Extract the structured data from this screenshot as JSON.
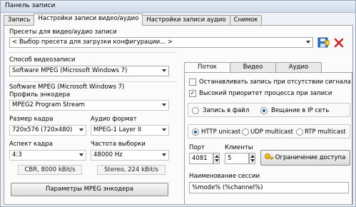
{
  "window": {
    "title": "Панель записи"
  },
  "tabs": [
    "Запись",
    "Настройки записи видео/аудио",
    "Настройки записи аудио",
    "Снимок"
  ],
  "presets": {
    "label": "Пресеты для видео/аудио записи",
    "value": "< Выбор пресета для загрузки конфигурации... >"
  },
  "capture": {
    "label": "Способ видеозаписи",
    "value": "Software MPEG (Microsoft Windows 7)"
  },
  "software": {
    "label": "Software MPEG (Microsoft Windows 7)",
    "encoder_profile_label": "Профиль энкодера",
    "encoder_profile_value": "MPEG2 Program Stream",
    "frame_size_label": "Размер кадра",
    "frame_size_value": "720x576 (720x480)",
    "audio_format_label": "Аудио формат",
    "audio_format_value": "MPEG-1 Layer II",
    "aspect_label": "Аспект кадра",
    "aspect_value": "4:3",
    "sample_rate_label": "Частота выборки",
    "sample_rate_value": "48000 Hz",
    "video_info": "CBR, 8000 kBit/s",
    "audio_info": "Stereo, 224 kBit/s",
    "mpeg_params_button": "Параметры MPEG энкодера"
  },
  "subtabs": [
    "Поток",
    "Видео",
    "Аудио"
  ],
  "stream": {
    "stop_on_no_signal": "Останавливать запись при отсутствии сигнала",
    "high_priority": "Высокий приоритет процесса при записи",
    "record_to_file": "Запись в файл",
    "broadcast_ip": "Вещание в IP сеть",
    "http_unicast": "HTTP unicast",
    "udp_multicast": "UDP multicast",
    "rtp_multicast": "RTP multicast",
    "port_label": "Порт",
    "port_value": "4081",
    "clients_label": "Клиенты",
    "clients_value": "5",
    "access_limit_button": "Ограничение доступа",
    "session_name_label": "Наименование сессии",
    "session_name_value": "%mode% (%channel%)"
  }
}
